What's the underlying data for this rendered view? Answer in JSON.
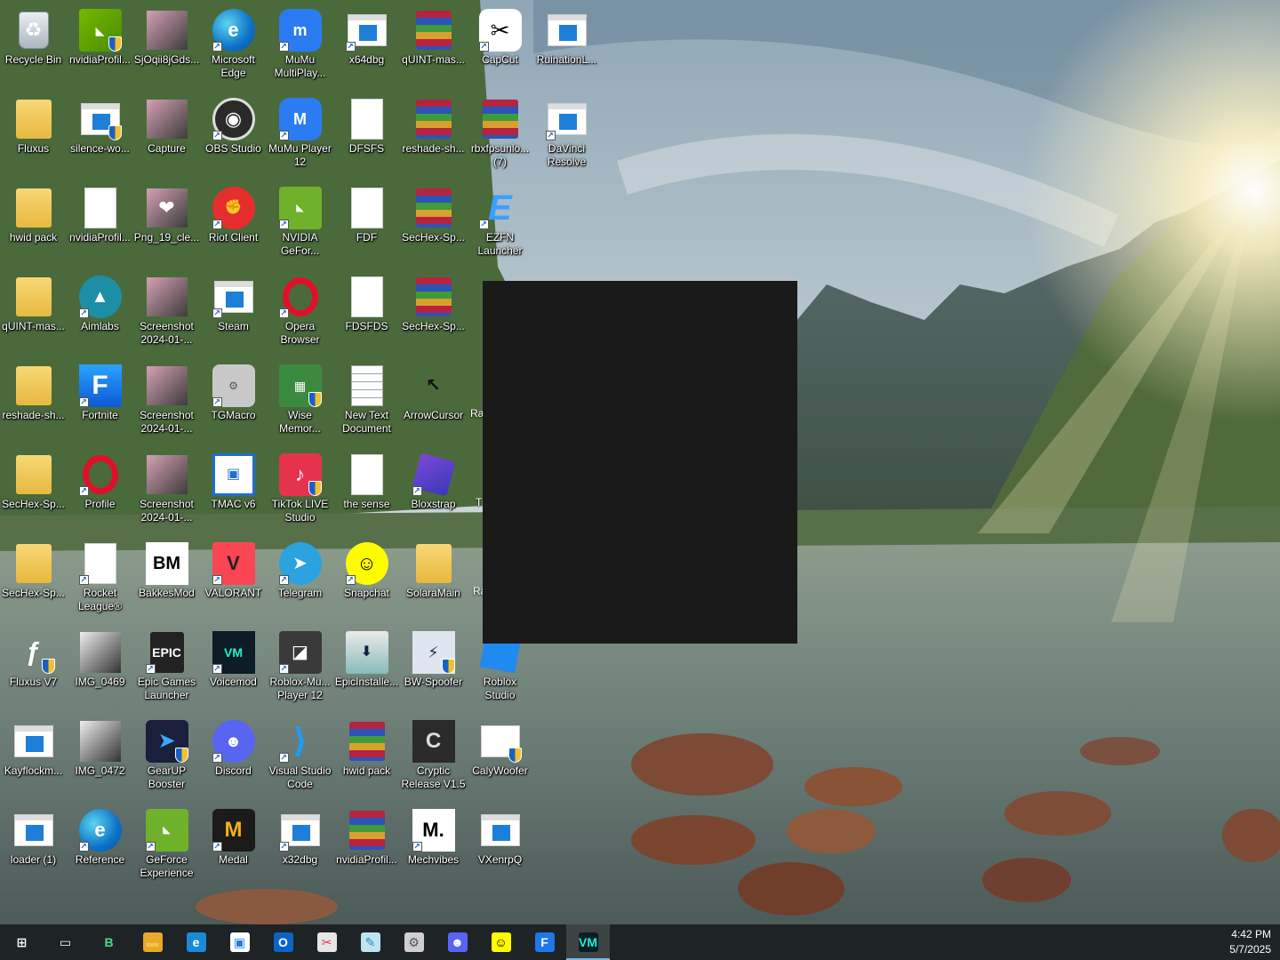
{
  "desktop": {
    "icons": [
      {
        "label": "Recycle Bin",
        "icon": "recycle-bin-icon",
        "style": "bin",
        "glyph": "♻",
        "col": 0,
        "row": 0
      },
      {
        "label": "nvidiaProfil...",
        "icon": "nvidia-profile-icon",
        "style": "nvidia",
        "glyph": "◣",
        "col": 1,
        "row": 0,
        "shield": true
      },
      {
        "label": "SjOqii8jGds...",
        "icon": "image-thumbnail-icon",
        "style": "shot",
        "glyph": "",
        "col": 2,
        "row": 0
      },
      {
        "label": "Microsoft\nEdge",
        "icon": "edge-icon",
        "style": "edge",
        "glyph": "e",
        "col": 3,
        "row": 0,
        "shortcut": true
      },
      {
        "label": "MuMu\nMultiPlay...",
        "icon": "mumu-multiplayer-icon",
        "style": "mumu",
        "glyph": "m",
        "col": 4,
        "row": 0,
        "shortcut": true
      },
      {
        "label": "x64dbg",
        "icon": "x64dbg-icon",
        "style": "app",
        "glyph": "",
        "col": 5,
        "row": 0,
        "shortcut": true
      },
      {
        "label": "qUINT-mas...",
        "icon": "winrar-archive-icon",
        "style": "rar",
        "glyph": "",
        "col": 6,
        "row": 0
      },
      {
        "label": "CapCut",
        "icon": "capcut-icon",
        "style": "capcut",
        "glyph": "✂",
        "col": 7,
        "row": 0,
        "shortcut": true
      },
      {
        "label": "RuinationL...",
        "icon": "ruination-icon",
        "style": "app",
        "glyph": "",
        "col": 8,
        "row": 0
      },
      {
        "label": "Fluxus",
        "icon": "folder-icon",
        "style": "folder",
        "glyph": "",
        "col": 0,
        "row": 1
      },
      {
        "label": "silence-wo...",
        "icon": "silence-app-icon",
        "style": "app",
        "glyph": "",
        "col": 1,
        "row": 1,
        "shield": true
      },
      {
        "label": "Capture",
        "icon": "capture-thumbnail-icon",
        "style": "shot",
        "glyph": "",
        "col": 2,
        "row": 1
      },
      {
        "label": "OBS Studio",
        "icon": "obs-icon",
        "style": "obs",
        "glyph": "◉",
        "col": 3,
        "row": 1,
        "shortcut": true
      },
      {
        "label": "MuMu Player\n12",
        "icon": "mumu-player-icon",
        "style": "mumu",
        "glyph": "M",
        "col": 4,
        "row": 1,
        "shortcut": true
      },
      {
        "label": "DFSFS",
        "icon": "blank-document-icon",
        "style": "doc",
        "glyph": "",
        "col": 5,
        "row": 1
      },
      {
        "label": "reshade-sh...",
        "icon": "winrar-archive-icon",
        "style": "rar",
        "glyph": "",
        "col": 6,
        "row": 1
      },
      {
        "label": "rbxfpsunlo...\n(7)",
        "icon": "winrar-archive-icon",
        "style": "rar",
        "glyph": "",
        "col": 7,
        "row": 1
      },
      {
        "label": "DaVinci\nResolve",
        "icon": "davinci-resolve-icon",
        "style": "app",
        "glyph": "",
        "col": 8,
        "row": 1,
        "shortcut": true
      },
      {
        "label": "hwid pack",
        "icon": "folder-icon",
        "style": "folder",
        "glyph": "",
        "col": 0,
        "row": 2
      },
      {
        "label": "nvidiaProfil...",
        "icon": "settings-gear-icon",
        "style": "doc",
        "glyph": "⚙",
        "col": 1,
        "row": 2
      },
      {
        "label": "Png_19_cle...",
        "icon": "heart-image-icon",
        "style": "shot",
        "glyph": "❤",
        "col": 2,
        "row": 2
      },
      {
        "label": "Riot Client",
        "icon": "riot-client-icon",
        "style": "riot",
        "glyph": "✊",
        "col": 3,
        "row": 2,
        "shortcut": true
      },
      {
        "label": "NVIDIA\nGeFor...",
        "icon": "nvidia-geforce-icon",
        "style": "gef",
        "glyph": "◣",
        "col": 4,
        "row": 2,
        "shortcut": true
      },
      {
        "label": "FDF",
        "icon": "blank-document-icon",
        "style": "doc",
        "glyph": "",
        "col": 5,
        "row": 2
      },
      {
        "label": "SecHex-Sp...",
        "icon": "winrar-archive-icon",
        "style": "rar",
        "glyph": "",
        "col": 6,
        "row": 2
      },
      {
        "label": "EZFN\nLauncher",
        "icon": "ezfn-launcher-icon",
        "style": "ezfn",
        "glyph": "E",
        "col": 7,
        "row": 2,
        "shortcut": true
      },
      {
        "label": "qUINT-mas...",
        "icon": "folder-icon",
        "style": "folder",
        "glyph": "",
        "col": 0,
        "row": 3
      },
      {
        "label": "Aimlabs",
        "icon": "aimlabs-icon",
        "style": "aim",
        "glyph": "▲",
        "col": 1,
        "row": 3,
        "shortcut": true
      },
      {
        "label": "Screenshot\n2024-01-...",
        "icon": "screenshot-icon",
        "style": "shot",
        "glyph": "",
        "col": 2,
        "row": 3
      },
      {
        "label": "Steam",
        "icon": "steam-icon",
        "style": "app",
        "glyph": "",
        "col": 3,
        "row": 3,
        "shortcut": true
      },
      {
        "label": "Opera\nBrowser",
        "icon": "opera-icon",
        "style": "opera",
        "glyph": "",
        "col": 4,
        "row": 3,
        "shortcut": true
      },
      {
        "label": "FDSFDS",
        "icon": "blank-document-icon",
        "style": "doc",
        "glyph": "",
        "col": 5,
        "row": 3
      },
      {
        "label": "SecHex-Sp...",
        "icon": "winrar-archive-icon",
        "style": "rar",
        "glyph": "",
        "col": 6,
        "row": 3
      },
      {
        "label": "reshade-sh...",
        "icon": "folder-icon",
        "style": "folder",
        "glyph": "",
        "col": 0,
        "row": 4
      },
      {
        "label": "Fortnite",
        "icon": "fortnite-icon",
        "style": "fortnite",
        "glyph": "F",
        "col": 1,
        "row": 4,
        "shortcut": true
      },
      {
        "label": "Screenshot\n2024-01-...",
        "icon": "screenshot-icon",
        "style": "shot",
        "glyph": "",
        "col": 2,
        "row": 4
      },
      {
        "label": "TGMacro",
        "icon": "tgmacro-icon",
        "style": "tg",
        "glyph": "⚙",
        "col": 3,
        "row": 4,
        "shortcut": true
      },
      {
        "label": "Wise\nMemor...",
        "icon": "wise-memory-icon",
        "style": "wise",
        "glyph": "▦",
        "col": 4,
        "row": 4,
        "shield": true
      },
      {
        "label": "New Text\nDocument",
        "icon": "text-document-icon",
        "style": "txt",
        "glyph": "",
        "col": 5,
        "row": 4
      },
      {
        "label": "ArrowCursor",
        "icon": "arrow-cursor-icon",
        "style": "cursor",
        "glyph": "↖",
        "col": 6,
        "row": 4
      },
      {
        "label": "SecHex-Sp...",
        "icon": "folder-icon",
        "style": "folder",
        "glyph": "",
        "col": 0,
        "row": 5
      },
      {
        "label": "Profile",
        "icon": "opera-icon",
        "style": "opera",
        "glyph": "",
        "col": 1,
        "row": 5,
        "shortcut": true
      },
      {
        "label": "Screenshot\n2024-01-...",
        "icon": "screenshot-icon",
        "style": "shot",
        "glyph": "",
        "col": 2,
        "row": 5
      },
      {
        "label": "TMAC v6",
        "icon": "tmac-icon",
        "style": "tmac",
        "glyph": "▣",
        "col": 3,
        "row": 5
      },
      {
        "label": "TikTok LIVE\nStudio",
        "icon": "tiktok-icon",
        "style": "tiktok",
        "glyph": "♪",
        "col": 4,
        "row": 5,
        "shield": true
      },
      {
        "label": "the sense",
        "icon": "blank-document-icon",
        "style": "doc",
        "glyph": "",
        "col": 5,
        "row": 5
      },
      {
        "label": "Bloxstrap",
        "icon": "bloxstrap-icon",
        "style": "blox",
        "glyph": "",
        "col": 6,
        "row": 5,
        "shortcut": true
      },
      {
        "label": "SecHex-Sp...",
        "icon": "folder-icon",
        "style": "folder",
        "glyph": "",
        "col": 0,
        "row": 6
      },
      {
        "label": "Rocket\nLeague®",
        "icon": "document-shortcut-icon",
        "style": "doc",
        "glyph": "",
        "col": 1,
        "row": 6,
        "shortcut": true
      },
      {
        "label": "BakkesMod",
        "icon": "bakkesmod-icon",
        "style": "bm",
        "glyph": "BM",
        "col": 2,
        "row": 6
      },
      {
        "label": "VALORANT",
        "icon": "valorant-icon",
        "style": "valo",
        "glyph": "V",
        "col": 3,
        "row": 6,
        "shortcut": true
      },
      {
        "label": "Telegram",
        "icon": "telegram-icon",
        "style": "telegram",
        "glyph": "➤",
        "col": 4,
        "row": 6,
        "shortcut": true
      },
      {
        "label": "Snapchat",
        "icon": "snapchat-icon",
        "style": "snap",
        "glyph": "☺",
        "col": 5,
        "row": 6,
        "shortcut": true
      },
      {
        "label": "SolaraMain",
        "icon": "folder-icon",
        "style": "folder",
        "glyph": "",
        "col": 6,
        "row": 6
      },
      {
        "label": "Fluxus V7",
        "icon": "fluxus-icon",
        "style": "fluxv7",
        "glyph": "ƒ",
        "col": 0,
        "row": 7,
        "shield": true
      },
      {
        "label": "IMG_0469",
        "icon": "photo-icon",
        "style": "img",
        "glyph": "",
        "col": 1,
        "row": 7
      },
      {
        "label": "Epic Games\nLauncher",
        "icon": "epic-games-icon",
        "style": "epic",
        "glyph": "EPIC",
        "col": 2,
        "row": 7,
        "shortcut": true
      },
      {
        "label": "Voicemod",
        "icon": "voicemod-icon",
        "style": "voice",
        "glyph": "VM",
        "col": 3,
        "row": 7,
        "shortcut": true
      },
      {
        "label": "Roblox-Mu...\nPlayer 12",
        "icon": "roblox-icon",
        "style": "roblox",
        "glyph": "◪",
        "col": 4,
        "row": 7,
        "shortcut": true
      },
      {
        "label": "EpicInstalle...",
        "icon": "installer-icon",
        "style": "installer",
        "glyph": "⬇",
        "col": 5,
        "row": 7
      },
      {
        "label": "BW-Spoofer",
        "icon": "bw-spoofer-icon",
        "style": "bw",
        "glyph": "⚡",
        "col": 6,
        "row": 7,
        "shield": true
      },
      {
        "label": "Roblox\nStudio",
        "icon": "roblox-studio-icon",
        "style": "robloxstudio",
        "glyph": "",
        "col": 7,
        "row": 7
      },
      {
        "label": "Kayflockm...",
        "icon": "app-window-icon",
        "style": "app",
        "glyph": "",
        "col": 0,
        "row": 8
      },
      {
        "label": "IMG_0472",
        "icon": "photo-icon",
        "style": "img",
        "glyph": "",
        "col": 1,
        "row": 8
      },
      {
        "label": "GearUP\nBooster",
        "icon": "gearup-icon",
        "style": "gearup",
        "glyph": "➤",
        "col": 2,
        "row": 8,
        "shield": true
      },
      {
        "label": "Discord",
        "icon": "discord-icon",
        "style": "discord",
        "glyph": "☻",
        "col": 3,
        "row": 8,
        "shortcut": true
      },
      {
        "label": "Visual Studio\nCode",
        "icon": "vscode-icon",
        "style": "vscode",
        "glyph": "⟩",
        "col": 4,
        "row": 8,
        "shortcut": true
      },
      {
        "label": "hwid pack",
        "icon": "winrar-archive-icon",
        "style": "rar",
        "glyph": "",
        "col": 5,
        "row": 8
      },
      {
        "label": "Cryptic\nRelease V1.5",
        "icon": "cryptic-icon",
        "style": "cryptic",
        "glyph": "C",
        "col": 6,
        "row": 8
      },
      {
        "label": "CalyWoofer",
        "icon": "calywoofer-icon",
        "style": "calywoofer",
        "glyph": "",
        "col": 7,
        "row": 8,
        "shield": true
      },
      {
        "label": "loader (1)",
        "icon": "app-window-icon",
        "style": "app",
        "glyph": "",
        "col": 0,
        "row": 9
      },
      {
        "label": "Reference",
        "icon": "edge-icon",
        "style": "edge",
        "glyph": "e",
        "col": 1,
        "row": 9,
        "shortcut": true
      },
      {
        "label": "GeForce\nExperience",
        "icon": "nvidia-geforce-icon",
        "style": "gef",
        "glyph": "◣",
        "col": 2,
        "row": 9,
        "shortcut": true
      },
      {
        "label": "Medal",
        "icon": "medal-icon",
        "style": "medal",
        "glyph": "M",
        "col": 3,
        "row": 9,
        "shortcut": true
      },
      {
        "label": "x32dbg",
        "icon": "x32dbg-icon",
        "style": "app",
        "glyph": "",
        "col": 4,
        "row": 9,
        "shortcut": true
      },
      {
        "label": "nvidiaProfil...",
        "icon": "winrar-archive-icon",
        "style": "rar",
        "glyph": "",
        "col": 5,
        "row": 9
      },
      {
        "label": "Mechvibes",
        "icon": "mechvibes-icon",
        "style": "mech",
        "glyph": "M.",
        "col": 6,
        "row": 9,
        "shortcut": true
      },
      {
        "label": "VXenrpQ",
        "icon": "app-window-icon",
        "style": "app",
        "glyph": "",
        "col": 7,
        "row": 9
      }
    ],
    "partial_labels": [
      "Ra",
      "Tr",
      "Ra"
    ]
  },
  "taskbar": {
    "buttons": [
      {
        "name": "start-button",
        "icon": "windows-logo-icon",
        "glyph": "⊞",
        "color": "#ffffff",
        "bg": "transparent"
      },
      {
        "name": "task-view-button",
        "icon": "task-view-icon",
        "glyph": "▭",
        "color": "#ffffff",
        "bg": "transparent"
      },
      {
        "name": "taskbar-app-b",
        "icon": "b-app-icon",
        "glyph": "B",
        "color": "#3fe08a",
        "bg": "transparent"
      },
      {
        "name": "taskbar-file-explorer",
        "icon": "folder-icon",
        "glyph": "▬",
        "color": "#f5c542",
        "bg": "#e8a82a"
      },
      {
        "name": "taskbar-edge",
        "icon": "edge-icon",
        "glyph": "e",
        "color": "#ffffff",
        "bg": "#1a8ad8"
      },
      {
        "name": "taskbar-app-window",
        "icon": "app-window-icon",
        "glyph": "▣",
        "color": "#1e7fd9",
        "bg": "#ffffff"
      },
      {
        "name": "taskbar-outlook",
        "icon": "outlook-icon",
        "glyph": "O",
        "color": "#ffffff",
        "bg": "#0a64c8"
      },
      {
        "name": "taskbar-snipping-tool",
        "icon": "snipping-tool-icon",
        "glyph": "✂",
        "color": "#e8334e",
        "bg": "#e6e6e6"
      },
      {
        "name": "taskbar-notes",
        "icon": "notes-icon",
        "glyph": "✎",
        "color": "#2a8ab8",
        "bg": "#bfe4f0"
      },
      {
        "name": "taskbar-tgmacro",
        "icon": "tgmacro-icon",
        "glyph": "⚙",
        "color": "#555555",
        "bg": "#cfcfcf"
      },
      {
        "name": "taskbar-discord",
        "icon": "discord-icon",
        "glyph": "☻",
        "color": "#ffffff",
        "bg": "#5865f2"
      },
      {
        "name": "taskbar-snapchat",
        "icon": "snapchat-icon",
        "glyph": "☺",
        "color": "#000000",
        "bg": "#fffc00"
      },
      {
        "name": "taskbar-fortnite",
        "icon": "fortnite-icon",
        "glyph": "F",
        "color": "#ffffff",
        "bg": "#1f78e8"
      },
      {
        "name": "taskbar-voicemod",
        "icon": "voicemod-icon",
        "glyph": "VM",
        "color": "#1ff1d0",
        "bg": "#0d1c26",
        "active": true
      }
    ],
    "clock": {
      "time": "4:42 PM",
      "date": "5/7/2025"
    }
  }
}
